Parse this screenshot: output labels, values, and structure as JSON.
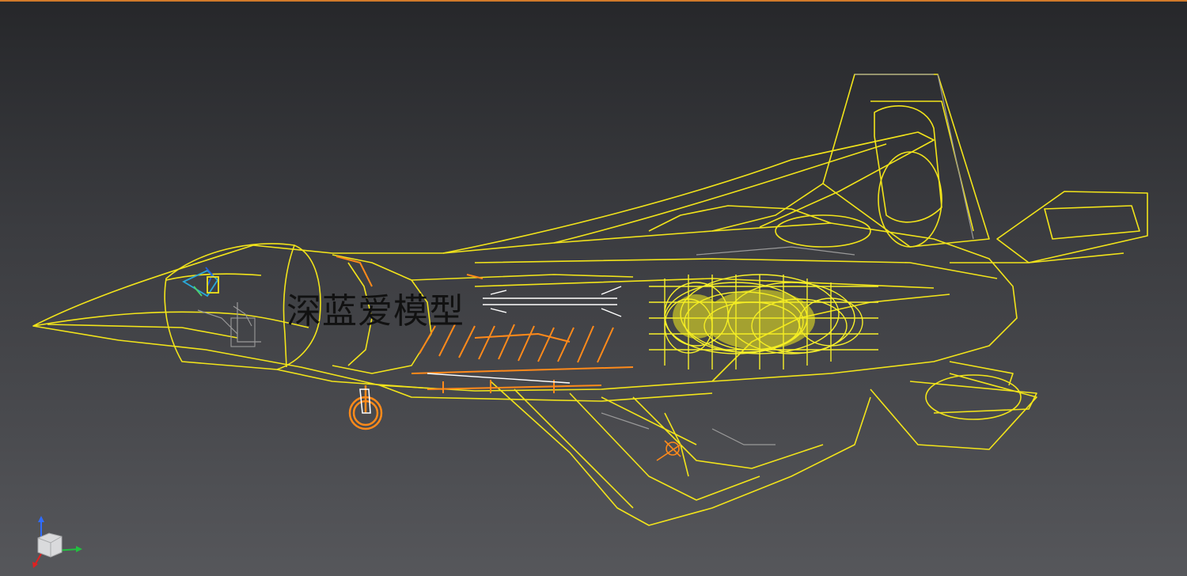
{
  "viewport": {
    "watermark_text": "深蓝爱模型",
    "background_top": "#26272a",
    "background_bottom": "#56575b",
    "wire_color": "#f2e41a",
    "accent_orange": "#ff8a1a",
    "frame_accent": "#d07a2a",
    "grey_wire": "#9a9a9a"
  },
  "model": {
    "subject": "fighter-jet-wireframe",
    "view": "left side"
  },
  "gizmo": {
    "axes": [
      "z",
      "x",
      "y"
    ],
    "colors": {
      "z": "#2f6cff",
      "x": "#e02020",
      "y": "#22c040"
    }
  }
}
